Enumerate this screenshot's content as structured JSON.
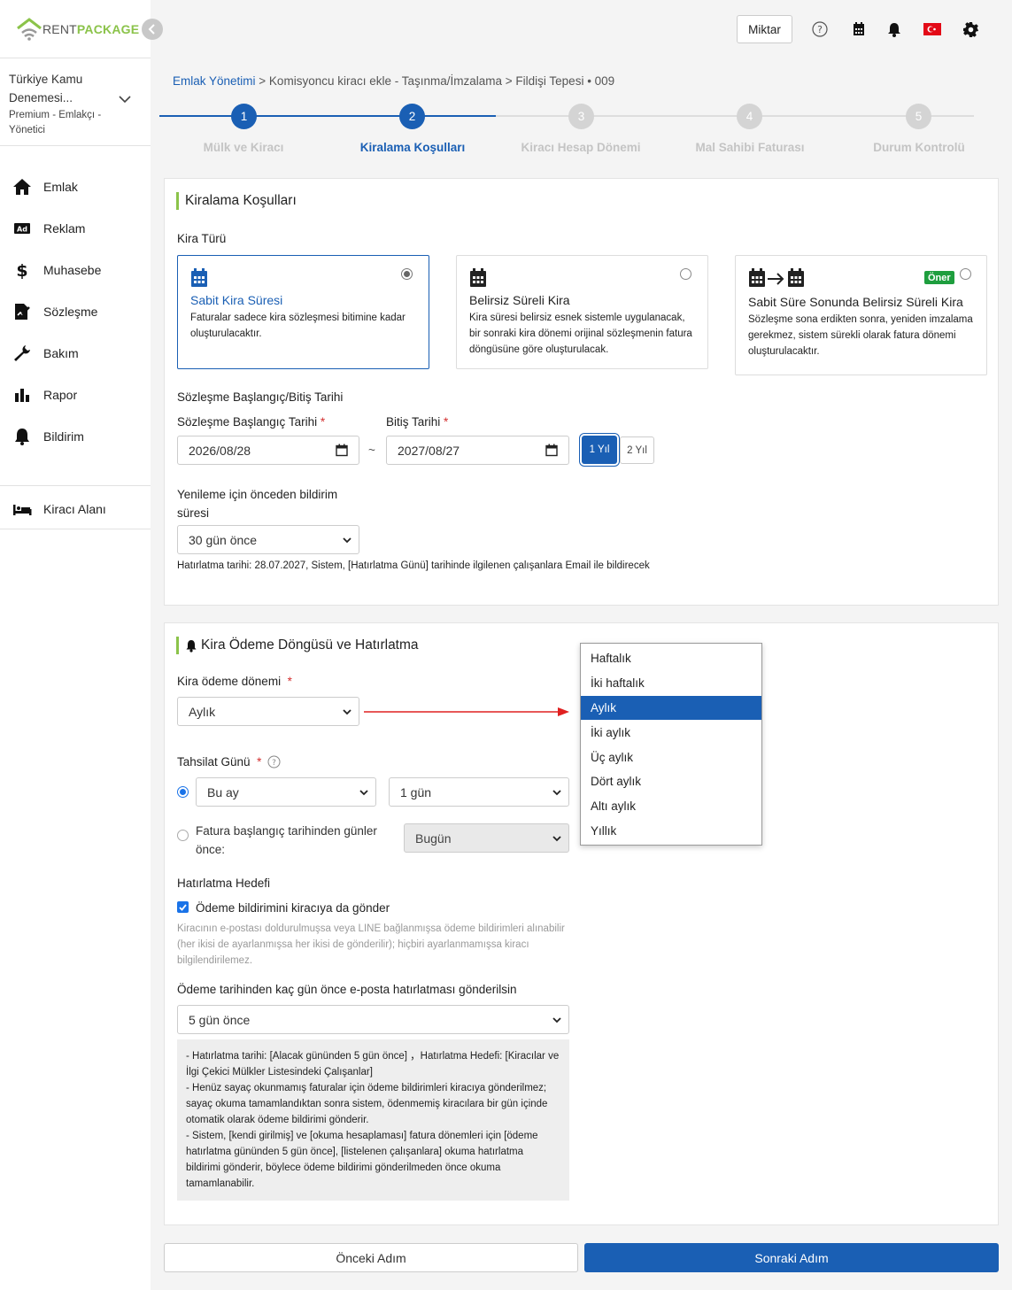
{
  "brand": {
    "part1": "RENT",
    "part2": "PACKAGE"
  },
  "org": {
    "name": "Türkiye Kamu Denemesi...",
    "role": "Premium - Emlakçı - Yönetici"
  },
  "sidebar": {
    "items": [
      {
        "label": "Emlak",
        "icon": "home-icon"
      },
      {
        "label": "Reklam",
        "icon": "ad-icon"
      },
      {
        "label": "Muhasebe",
        "icon": "dollar-icon"
      },
      {
        "label": "Sözleşme",
        "icon": "contract-icon"
      },
      {
        "label": "Bakım",
        "icon": "wrench-icon"
      },
      {
        "label": "Rapor",
        "icon": "chart-icon"
      },
      {
        "label": "Bildirim",
        "icon": "bell-icon"
      }
    ],
    "tenant": {
      "label": "Kiracı Alanı",
      "icon": "bed-icon"
    }
  },
  "topbar": {
    "amount_label": "Miktar"
  },
  "breadcrumb": {
    "root": "Emlak Yönetimi",
    "rest": " > Komisyoncu kiracı ekle - Taşınma/İmzalama > Fildişi Tepesi • 009"
  },
  "steps": [
    {
      "num": "1",
      "label": "Mülk ve Kiracı"
    },
    {
      "num": "2",
      "label": "Kiralama Koşulları"
    },
    {
      "num": "3",
      "label": "Kiracı Hesap Dönemi"
    },
    {
      "num": "4",
      "label": "Mal Sahibi Faturası"
    },
    {
      "num": "5",
      "label": "Durum Kontrolü"
    }
  ],
  "conditions": {
    "title": "Kiralama Koşulları",
    "rent_type_label": "Kira Türü",
    "options": [
      {
        "title": "Sabit Kira Süresi",
        "desc": "Faturalar sadece kira sözleşmesi bitimine kadar oluşturulacaktır."
      },
      {
        "title": "Belirsiz Süreli Kira",
        "desc": "Kira süresi belirsiz esnek sistemle uygulanacak, bir sonraki kira dönemi orijinal sözleşmenin fatura döngüsüne göre oluşturulacak."
      },
      {
        "title": "Sabit Süre Sonunda Belirsiz Süreli Kira",
        "desc": "Sözleşme sona erdikten sonra, yeniden imzalama gerekmez, sistem sürekli olarak fatura dönemi oluşturulacaktır.",
        "badge": "Öner"
      }
    ],
    "dates_label": "Sözleşme Başlangıç/Bitiş Tarihi",
    "start_label": "Sözleşme Başlangıç Tarihi",
    "end_label": "Bitiş Tarihi",
    "required_mark": "*",
    "start_value": "2026/08/28",
    "end_value": "2027/08/27",
    "tilde": "~",
    "year1": "1 Yıl",
    "year2": "2 Yıl",
    "renewal_label_1": "Yenileme için önceden bildirim",
    "renewal_label_2": "süresi",
    "renewal_value": "30 gün önce",
    "renewal_note": "Hatırlatma tarihi: 28.07.2027, Sistem, [Hatırlatma Günü] tarihinde ilgilenen çalışanlara Email ile bildirecek"
  },
  "payment": {
    "title": "Kira Ödeme Döngüsü ve Hatırlatma",
    "period_label": "Kira ödeme dönemi",
    "required_mark": "*",
    "period_value": "Aylık",
    "period_options": [
      "Haftalık",
      "İki haftalık",
      "Aylık",
      "İki aylık",
      "Üç aylık",
      "Dört aylık",
      "Altı aylık",
      "Yıllık"
    ],
    "collection_label": "Tahsilat Günü",
    "month_value": "Bu ay",
    "day_value": "1 gün",
    "invoice_option_1": "Fatura başlangıç tarihinden günler",
    "invoice_option_2": "önce:",
    "invoice_value": "Bugün",
    "target_label": "Hatırlatma Hedefi",
    "target_check": "Ödeme bildirimini kiracıya da gönder",
    "target_note": "Kiracının e-postası doldurulmuşsa veya LINE bağlanmışsa ödeme bildirimleri alınabilir (her ikisi de ayarlanmışsa her ikisi de gönderilir); hiçbiri ayarlanmamışsa kiracı bilgilendirilemez.",
    "email_label": "Ödeme tarihinden kaç gün önce e-posta hatırlatması gönderilsin",
    "email_value": "5 gün önce",
    "info": [
      "- Hatırlatma tarihi: [Alacak gününden 5 gün önce] ，Hatırlatma Hedefi: [Kiracılar ve İlgi Çekici Mülkler Listesindeki Çalışanlar]",
      "- Henüz sayaç okunmamış faturalar için ödeme bildirimleri kiracıya gönderilmez; sayaç okuma tamamlandıktan sonra sistem, ödenmemiş kiracılara bir gün içinde otomatik olarak ödeme bildirimi gönderir.",
      "- Sistem, [kendi girilmiş] ve [okuma hesaplaması] fatura dönemleri için [ödeme hatırlatma gününden 5 gün önce], [listelenen çalışanlara] okuma hatırlatma bildirimi gönderir, böylece ödeme bildirimi gönderilmeden önce okuma tamamlanabilir."
    ]
  },
  "footer": {
    "prev": "Önceki Adım",
    "next": "Sonraki Adım"
  },
  "colors": {
    "primary": "#1a5fb4",
    "accent_green": "#8bc34a",
    "arrow_red": "#e02020"
  }
}
